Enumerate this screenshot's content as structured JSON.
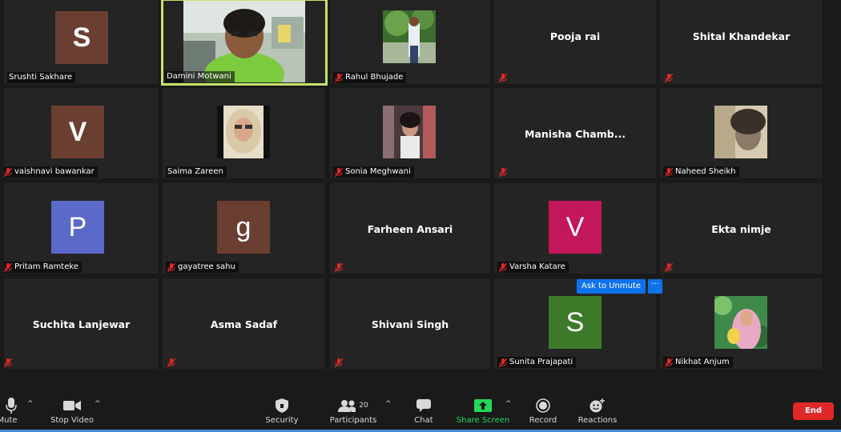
{
  "participants": [
    {
      "name": "Srushti Sakhare",
      "label": "Srushti Sakhare",
      "muted": false,
      "avatar_letter": "S",
      "avatar_color": "#6b3e32"
    },
    {
      "name": "Damini Motwani",
      "label": "Damini Motwani",
      "muted": false,
      "active_speaker": true
    },
    {
      "name": "Rahul Bhujade",
      "label": "Rahul Bhujade",
      "muted": true,
      "photo": "man-with-tree"
    },
    {
      "name": "Pooja rai",
      "display_name": "Pooja rai",
      "muted": true
    },
    {
      "name": "Shital Khandekar",
      "display_name": "Shital Khandekar",
      "muted": true
    },
    {
      "name": "vaishnavi bawankar",
      "label": "vaishnavi bawankar",
      "muted": true,
      "avatar_letter": "V",
      "avatar_color": "#6b3e32"
    },
    {
      "name": "Saima Zareen",
      "label": "Saima Zareen",
      "muted": false,
      "photo": "woman-hijab"
    },
    {
      "name": "Sonia Meghwani",
      "label": "Sonia Meghwani",
      "muted": true,
      "photo": "woman-outdoor"
    },
    {
      "name": "Manisha Chamb...",
      "display_name": "Manisha  Chamb...",
      "muted": true
    },
    {
      "name": "Naheed Sheikh",
      "label": "Naheed Sheikh",
      "muted": true,
      "photo": "woman-sepia"
    },
    {
      "name": "Pritam Ramteke",
      "label": "Pritam Ramteke",
      "muted": true,
      "avatar_letter": "P",
      "avatar_color": "#5b69c9"
    },
    {
      "name": "gayatree sahu",
      "label": "gayatree sahu",
      "muted": true,
      "avatar_letter": "g",
      "avatar_color": "#6b3e32"
    },
    {
      "name": "Farheen Ansari",
      "display_name": "Farheen Ansari",
      "muted": true
    },
    {
      "name": "Varsha Katare",
      "label": "Varsha Katare",
      "muted": true,
      "avatar_letter": "V",
      "avatar_color": "#c2185b"
    },
    {
      "name": "Ekta nimje",
      "display_name": "Ekta nimje",
      "muted": true
    },
    {
      "name": "Suchita Lanjewar",
      "display_name": "Suchita Lanjewar",
      "muted": true
    },
    {
      "name": "Asma Sadaf",
      "display_name": "Asma Sadaf",
      "muted": true
    },
    {
      "name": "Shivani Singh",
      "display_name": "Shivani Singh",
      "muted": true
    },
    {
      "name": "Sunita Prajapati",
      "label": "Sunita Prajapati",
      "muted": true,
      "avatar_letter": "S",
      "avatar_color": "#3d7a2a"
    },
    {
      "name": "Nikhat Anjum",
      "label": "Nikhat Anjum",
      "muted": true,
      "photo": "woman-pink-hijab"
    }
  ],
  "hover_menu": {
    "ask_to_unmute": "Ask to Unmute",
    "more": "···"
  },
  "toolbar": {
    "mute": "Mute",
    "stop_video": "Stop Video",
    "security": "Security",
    "participants": "Participants",
    "participants_count": "20",
    "chat": "Chat",
    "share_screen": "Share Screen",
    "record": "Record",
    "reactions": "Reactions",
    "end": "End"
  },
  "colors": {
    "active_border": "#c7e36a",
    "share_green": "#23d959",
    "end_red": "#e02828",
    "unmute_blue": "#0e72ed",
    "muted_red": "#e02828"
  }
}
